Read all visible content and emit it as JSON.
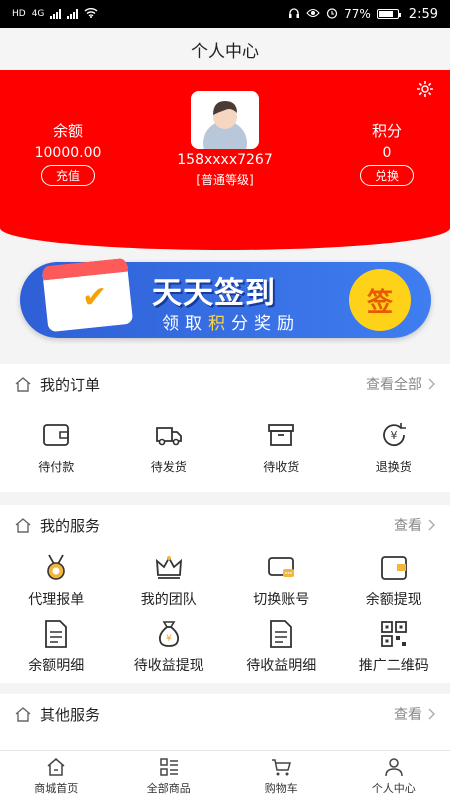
{
  "status_bar": {
    "network": "4G",
    "battery": "77%",
    "time": "2:59"
  },
  "page_title": "个人中心",
  "account": {
    "balance_label": "余额",
    "balance_value": "10000.00",
    "recharge_label": "充值",
    "points_label": "积分",
    "points_value": "0",
    "exchange_label": "兑换",
    "phone": "158xxxx7267",
    "level": "[普通等级]"
  },
  "banner": {
    "title": "天天签到",
    "subtitle": [
      "领",
      "取",
      "积",
      "分",
      "奖",
      "励"
    ],
    "button": "签"
  },
  "orders": {
    "title": "我的订单",
    "more": "查看全部",
    "items": [
      {
        "label": "待付款",
        "icon": "wallet-icon"
      },
      {
        "label": "待发货",
        "icon": "truck-icon"
      },
      {
        "label": "待收货",
        "icon": "box-icon"
      },
      {
        "label": "退换货",
        "icon": "refund-icon"
      }
    ]
  },
  "services": {
    "title": "我的服务",
    "more": "查看",
    "row1": [
      {
        "label": "代理报单",
        "icon": "medal-icon"
      },
      {
        "label": "我的团队",
        "icon": "crown-icon"
      },
      {
        "label": "切换账号",
        "icon": "chat-icon"
      },
      {
        "label": "余额提现",
        "icon": "wallet-icon"
      }
    ],
    "row2": [
      {
        "label": "余额明细",
        "icon": "document-icon"
      },
      {
        "label": "待收益提现",
        "icon": "money-bag-icon"
      },
      {
        "label": "待收益明细",
        "icon": "document-icon"
      },
      {
        "label": "推广二维码",
        "icon": "qrcode-icon"
      }
    ]
  },
  "other": {
    "title": "其他服务",
    "more": "查看"
  },
  "nav": [
    {
      "label": "商城首页",
      "icon": "home-icon"
    },
    {
      "label": "全部商品",
      "icon": "grid-list-icon"
    },
    {
      "label": "购物车",
      "icon": "cart-icon"
    },
    {
      "label": "个人中心",
      "icon": "user-icon"
    }
  ],
  "colors": {
    "brand_red": "#ff0000",
    "banner_blue": "#3b74ea",
    "gold": "#ffd21a"
  }
}
